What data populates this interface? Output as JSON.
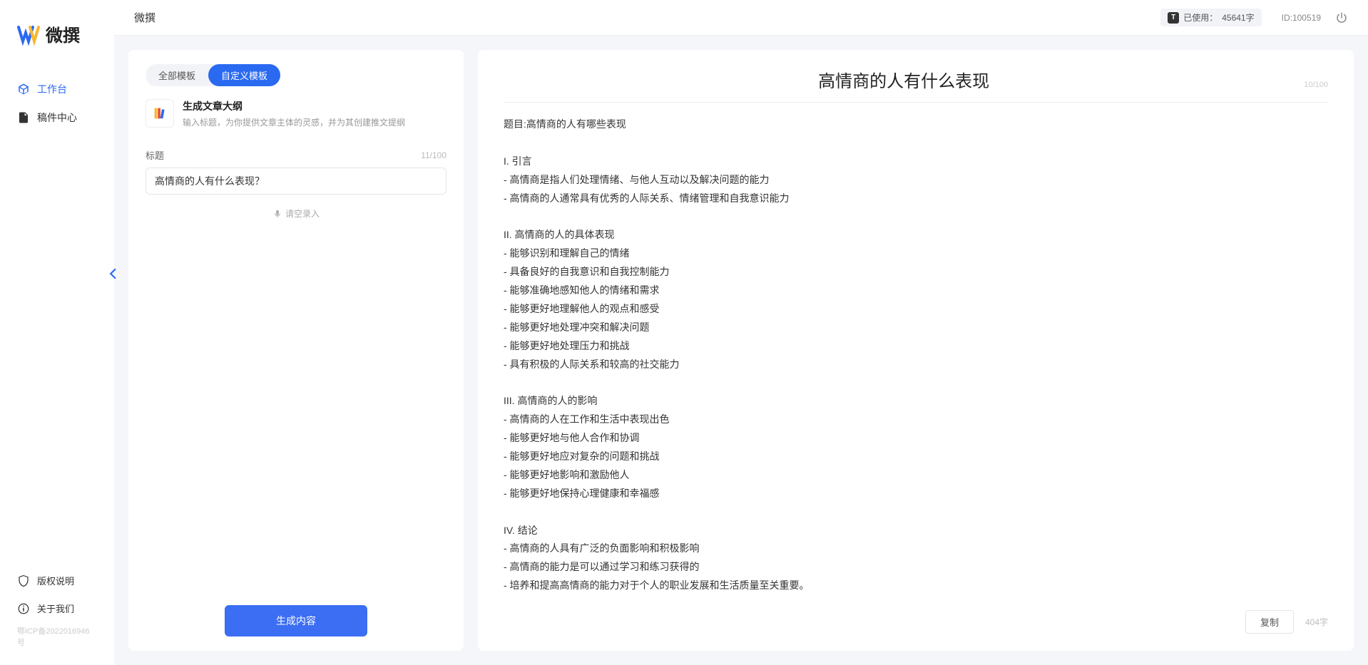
{
  "brand": {
    "name": "微撰"
  },
  "header": {
    "title": "微撰",
    "usage_label": "已使用：",
    "usage_value": "45641字",
    "id_label": "ID:100519"
  },
  "sidebar": {
    "items": [
      {
        "label": "工作台",
        "active": true
      },
      {
        "label": "稿件中心",
        "active": false
      }
    ],
    "bottom": [
      {
        "label": "版权说明"
      },
      {
        "label": "关于我们"
      }
    ],
    "icp": "鄂ICP备2022016946号"
  },
  "tabs": [
    {
      "label": "全部模板",
      "active": false
    },
    {
      "label": "自定义模板",
      "active": true
    }
  ],
  "template": {
    "title": "生成文章大纲",
    "desc": "输入标题，为你提供文章主体的灵感，并为其创建推文提纲"
  },
  "input": {
    "label": "标题",
    "count": "11/100",
    "value": "高情商的人有什么表现？",
    "voice_label": "请空录入"
  },
  "actions": {
    "generate": "生成内容",
    "copy": "复制"
  },
  "output": {
    "title": "高情商的人有什么表现",
    "title_count": "10/100",
    "char_count": "404字",
    "body": "题目:高情商的人有哪些表现\n\nI. 引言\n- 高情商是指人们处理情绪、与他人互动以及解决问题的能力\n- 高情商的人通常具有优秀的人际关系、情绪管理和自我意识能力\n\nII. 高情商的人的具体表现\n- 能够识别和理解自己的情绪\n- 具备良好的自我意识和自我控制能力\n- 能够准确地感知他人的情绪和需求\n- 能够更好地理解他人的观点和感受\n- 能够更好地处理冲突和解决问题\n- 能够更好地处理压力和挑战\n- 具有积极的人际关系和较高的社交能力\n\nIII. 高情商的人的影响\n- 高情商的人在工作和生活中表现出色\n- 能够更好地与他人合作和协调\n- 能够更好地应对复杂的问题和挑战\n- 能够更好地影响和激励他人\n- 能够更好地保持心理健康和幸福感\n\nIV. 结论\n- 高情商的人具有广泛的负面影响和积极影响\n- 高情商的能力是可以通过学习和练习获得的\n- 培养和提高高情商的能力对于个人的职业发展和生活质量至关重要。"
  }
}
